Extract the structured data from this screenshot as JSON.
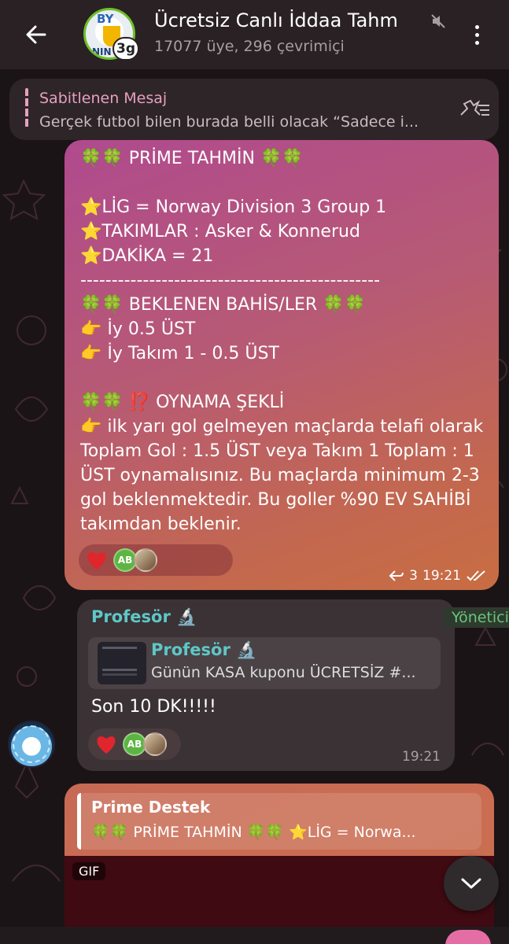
{
  "header": {
    "title": "Ücretsiz Canlı İddaa Tahm",
    "subtitle": "17077 üye, 296 çevrimiçi",
    "avatar_badge": "3g",
    "avatar_text_top": "BY",
    "avatar_text_bottom": "NIN"
  },
  "pinned": {
    "label": "Sabitlenen Mesaj",
    "text": "Gerçek futbol bilen burada belli olacak  “Sadece i..."
  },
  "messages": [
    {
      "body": "🍀🍀 PRİME TAHMİN 🍀🍀\n\n⭐LİG = Norway Division 3 Group 1\n⭐TAKIMLAR : Asker & Konnerud\n⭐DAKİKA = 21\n------------------------------------------------\n🍀🍀 BEKLENEN BAHİS/LER 🍀🍀\n👉 İy 0.5 ÜST\n👉 İy Takım 1 - 0.5 ÜST\n\n🍀🍀 ⁉️ OYNAMA ŞEKLİ\n👉 ilk yarı gol gelmeyen maçlarda telafi olarak Toplam Gol : 1.5 ÜST veya Takım 1 Toplam : 1 ÜST oynamalısınız. Bu maçlarda minimum 2-3 gol beklenmektedir. Bu goller %90 EV SAHİBİ takımdan beklenir.",
      "reaction_initials": "AB",
      "reply_count": "3",
      "time": "19:21"
    },
    {
      "sender": "Profesör 🔬",
      "role": "Yönetici",
      "reply_name": "Profesör 🔬",
      "reply_text": "Günün KASA kuponu ÜCRETSİZ #...",
      "text": "Son 10 DK!!!!!",
      "reaction_initials": "AB",
      "time": "19:21"
    },
    {
      "reply_name": "Prime Destek",
      "reply_text": "🍀🍀 PRİME TAHMİN 🍀🍀  ⭐LİG = Norwa...",
      "media_badge": "GIF"
    }
  ],
  "icons": {
    "back": "arrow-left-icon",
    "mute": "mute-icon",
    "more": "more-vertical-icon",
    "pin": "pin-list-icon",
    "heart": "heart-icon",
    "reply": "reply-arrow-icon",
    "read": "double-check-icon",
    "scroll": "chevron-down-icon"
  },
  "colors": {
    "header_bg": "#2a2124",
    "accent_pink": "#e7a0bf",
    "sender_teal": "#5fc7c7",
    "admin_green": "#67c67a",
    "bubble_gradient_start": "#b04a8e",
    "bubble_gradient_end": "#c86d42"
  }
}
